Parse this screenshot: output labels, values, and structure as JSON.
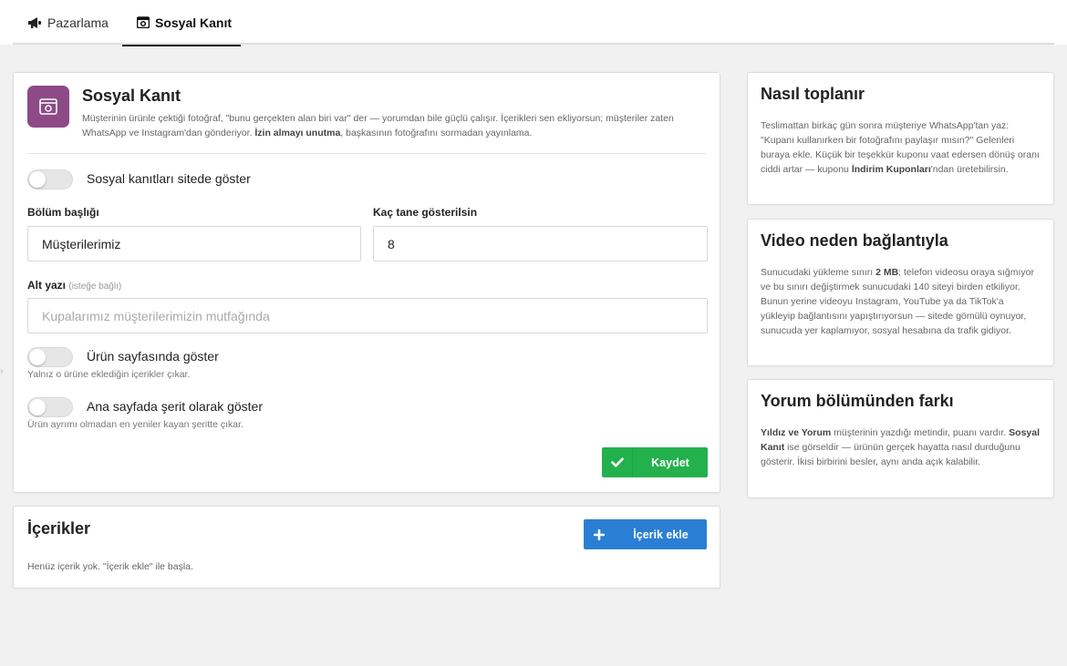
{
  "tabs": [
    {
      "label": "Pazarlama",
      "icon": "megaphone-icon",
      "active": false
    },
    {
      "label": "Sosyal Kanıt",
      "icon": "camera-icon",
      "active": true
    }
  ],
  "settings": {
    "title": "Sosyal Kanıt",
    "description_part1": "Müşterinin ürünle çektiği fotoğraf, \"bunu gerçekten alan biri var\" der — yorumdan bile güçlü çalışır. İçerikleri sen ekliyorsun; müşteriler zaten WhatsApp ve Instagram'dan gönderiyor. ",
    "description_bold": "İzin almayı unutma",
    "description_part2": ", başkasının fotoğrafını sormadan yayınlama.",
    "toggle_show_label": "Sosyal kanıtları sitede göster",
    "section_title_label": "Bölüm başlığı",
    "section_title_value": "Müşterilerimiz",
    "count_label": "Kaç tane gösterilsin",
    "count_value": "8",
    "subtitle_label": "Alt yazı",
    "subtitle_optional": "(isteğe bağlı)",
    "subtitle_placeholder": "Kupalarımız müşterilerimizin mutfağında",
    "toggle_product_label": "Ürün sayfasında göster",
    "toggle_product_hint": "Yalnız o ürüne eklediğin içerikler çıkar.",
    "toggle_home_label": "Ana sayfada şerit olarak göster",
    "toggle_home_hint": "Ürün ayrımı olmadan en yeniler kayan şeritte çıkar.",
    "save_label": "Kaydet",
    "brand_color": "#8d4a86",
    "save_color": "#22b14c"
  },
  "contents": {
    "title": "İçerikler",
    "add_label": "İçerik ekle",
    "empty_text": "Henüz içerik yok. \"İçerik ekle\" ile başla.",
    "add_color": "#2a7fd4"
  },
  "side": {
    "how": {
      "title": "Nasıl toplanır",
      "text1": "Teslimattan birkaç gün sonra müşteriye WhatsApp'tan yaz: \"Kupanı kullanırken bir fotoğrafını paylaşır mısın?\" Gelenleri buraya ekle. Küçük bir teşekkür kuponu vaat edersen dönüş oranı ciddi artar — kuponu ",
      "bold": "İndirim Kuponları",
      "text2": "'ndan üretebilirsin."
    },
    "video": {
      "title": "Video neden bağlantıyla",
      "text1": "Sunucudaki yükleme sınırı ",
      "bold": "2 MB",
      "text2": "; telefon videosu oraya sığmıyor ve bu sınırı değiştirmek sunucudaki 140 siteyi birden etkiliyor. Bunun yerine videoyu Instagram, YouTube ya da TikTok'a yükleyip bağlantısını yapıştırıyorsun — sitede gömülü oynuyor, sunucuda yer kaplamıyor, sosyal hesabına da trafik gidiyor."
    },
    "diff": {
      "title": "Yorum bölümünden farkı",
      "bold1": "Yıldız ve Yorum",
      "text1": " müşterinin yazdığı metindir, puanı vardır. ",
      "bold2": "Sosyal Kanıt",
      "text2": " ise görseldir — ürünün gerçek hayatta nasıl durduğunu gösterir. İkisi birbirini besler, aynı anda açık kalabilir."
    }
  }
}
